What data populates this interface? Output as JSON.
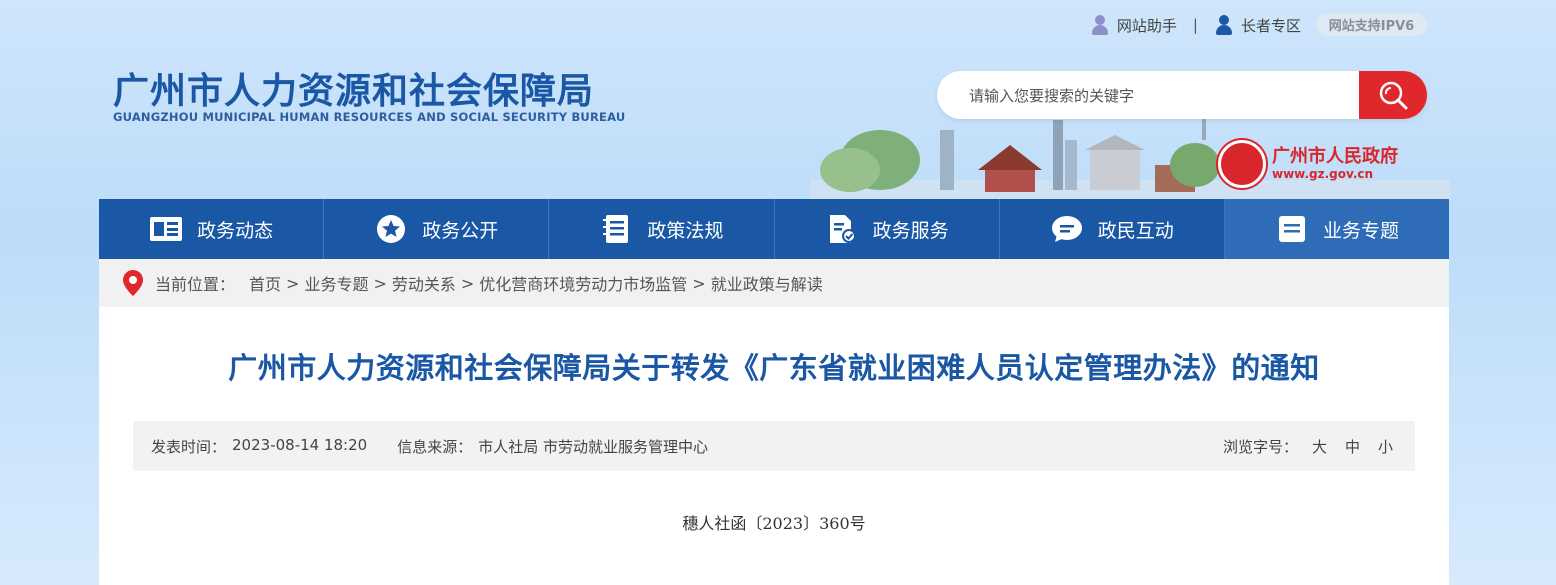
{
  "header": {
    "helper_label": "网站助手",
    "elder_label": "长者专区",
    "ipv6_label": "网站支持IPV6",
    "logo_cn": "广州市人力资源和社会保障局",
    "logo_en": "GUANGZHOU MUNICIPAL HUMAN RESOURCES AND SOCIAL SECURITY BUREAU",
    "search_placeholder": "请输入您要搜索的关键字",
    "gov_name": "广州市人民政府",
    "gov_url": "www.gz.gov.cn"
  },
  "nav": {
    "tabs": [
      {
        "label": "政务动态",
        "icon": "news-icon"
      },
      {
        "label": "政务公开",
        "icon": "star-badge-icon"
      },
      {
        "label": "政策法规",
        "icon": "notebook-icon"
      },
      {
        "label": "政务服务",
        "icon": "document-edit-icon"
      },
      {
        "label": "政民互动",
        "icon": "chat-bubble-icon"
      },
      {
        "label": "业务专题",
        "icon": "list-icon"
      }
    ],
    "active_index": 5
  },
  "breadcrumb": {
    "prefix": "当前位置：",
    "items": [
      "首页",
      "业务专题",
      "劳动关系",
      "优化营商环境劳动力市场监管",
      "就业政策与解读"
    ],
    "separator": ">"
  },
  "article": {
    "title": "广州市人力资源和社会保障局关于转发《广东省就业困难人员认定管理办法》的通知",
    "publish_label": "发表时间：",
    "publish_time": "2023-08-14 18:20",
    "source_label": "信息来源：",
    "source": "市人社局 市劳动就业服务管理中心",
    "font_label": "浏览字号：",
    "font_sizes": [
      "大",
      "中",
      "小"
    ],
    "doc_number": "穗人社函〔2023〕360号"
  },
  "colors": {
    "brand_blue": "#1a57a5",
    "search_red": "#e0272b",
    "gov_red": "#d8262c"
  }
}
